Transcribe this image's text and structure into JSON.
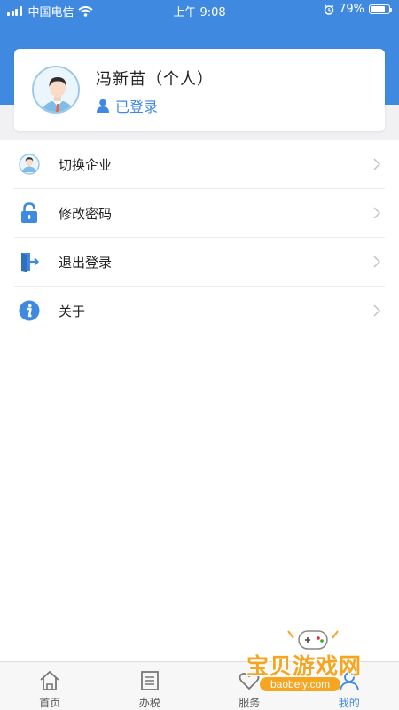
{
  "status_bar": {
    "carrier": "中国电信",
    "time": "上午 9:08",
    "battery": "79%",
    "battery_level": 0.79
  },
  "profile": {
    "name": "冯新苗（个人）",
    "status": "已登录"
  },
  "menu": [
    {
      "label": "切换企业",
      "icon": "user-avatar-icon"
    },
    {
      "label": "修改密码",
      "icon": "lock-icon"
    },
    {
      "label": "退出登录",
      "icon": "logout-door-icon"
    },
    {
      "label": "关于",
      "icon": "info-icon"
    }
  ],
  "tabs": [
    {
      "label": "首页",
      "icon": "home-icon",
      "active": false
    },
    {
      "label": "办税",
      "icon": "list-icon",
      "active": false
    },
    {
      "label": "服务",
      "icon": "heart-icon",
      "active": false
    },
    {
      "label": "我的",
      "icon": "profile-icon",
      "active": true
    }
  ],
  "watermark": {
    "title": "宝贝游戏网",
    "url": "baobeiy.com"
  },
  "colors": {
    "primary": "#3f8ae0",
    "background_band": "#f1f1f3",
    "watermark": "#f5a51f"
  }
}
